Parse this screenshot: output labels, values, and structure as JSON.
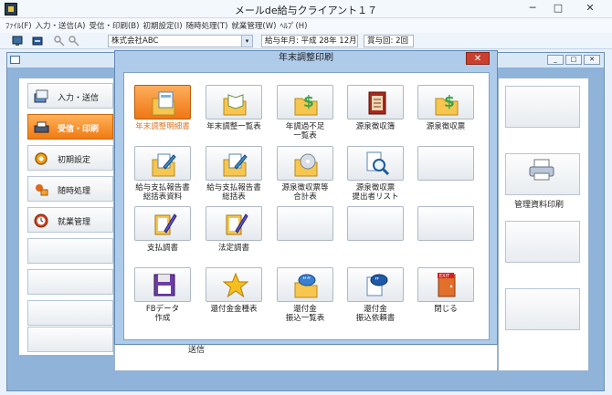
{
  "window": {
    "title": "メールde給与クライアント１７",
    "minimize": "─",
    "maximize": "□",
    "close": "✕"
  },
  "menu": [
    "ﾌｧｲﾙ(F)",
    "入力・送信(A)",
    "受信・印刷(B)",
    "初期設定(I)",
    "随時処理(T)",
    "就業管理(W)",
    "ﾍﾙﾌﾟ(H)"
  ],
  "toolbar": {
    "company": "株式会社ABC",
    "pay_year_month": "給与年月: 平成 28年 12月",
    "bonus_count": "賞与回: 2回",
    "dropdown_glyph": "▾"
  },
  "mdi_buttons": [
    "_",
    "□",
    "✕"
  ],
  "nav": [
    {
      "label": "入力・送信",
      "icon": "input-send-icon"
    },
    {
      "label": "受信・印刷",
      "icon": "receive-print-icon",
      "active": true
    },
    {
      "label": "初期設定",
      "icon": "settings-gear-icon"
    },
    {
      "label": "随時処理",
      "icon": "tools-icon"
    },
    {
      "label": "就業管理",
      "icon": "clock-icon"
    }
  ],
  "right_panel": {
    "printer_label": "管理資料印刷"
  },
  "under_label": "送信",
  "dialog": {
    "title": "年末調整印刷",
    "close": "✕",
    "tiles": [
      {
        "lines": [
          "年末調整明細書"
        ],
        "icon": "folder-doc-icon",
        "selected": true
      },
      {
        "lines": [
          "年末調整一覧表"
        ],
        "icon": "folder-book-icon"
      },
      {
        "lines": [
          "年調過不足",
          "一覧表"
        ],
        "icon": "folder-dollar-icon"
      },
      {
        "lines": [
          "源泉徴収簿"
        ],
        "icon": "red-ledger-icon"
      },
      {
        "lines": [
          "源泉徴収票"
        ],
        "icon": "folder-dollar-icon"
      },
      {
        "lines": [
          "給与支払報告書",
          "総括表資料"
        ],
        "icon": "folder-pencil-icon"
      },
      {
        "lines": [
          "給与支払報告書",
          "総括表"
        ],
        "icon": "folder-pencil-icon"
      },
      {
        "lines": [
          "源泉徴収票等",
          "合計表"
        ],
        "icon": "folder-cd-icon"
      },
      {
        "lines": [
          "源泉徴収票",
          "提出者リスト"
        ],
        "icon": "magnifier-doc-icon"
      },
      {
        "lines": [],
        "icon": ""
      },
      {
        "lines": [
          "支払調書"
        ],
        "icon": "clipboard-pen-icon"
      },
      {
        "lines": [
          "法定調書"
        ],
        "icon": "clipboard-pen-icon"
      },
      {
        "lines": [],
        "icon": ""
      },
      {
        "lines": [],
        "icon": ""
      },
      {
        "lines": [],
        "icon": ""
      },
      {
        "lines": [
          "FBデータ",
          "作成"
        ],
        "icon": "floppy-disk-icon"
      },
      {
        "lines": [
          "還付金金種表"
        ],
        "icon": "star-icon"
      },
      {
        "lines": [
          "還付金",
          "振込一覧表"
        ],
        "icon": "speech-folder-icon"
      },
      {
        "lines": [
          "還付金",
          "振込依頼書"
        ],
        "icon": "speech-doc-icon"
      },
      {
        "lines": [
          "閉じる"
        ],
        "icon": "exit-door-icon"
      }
    ]
  },
  "colors": {
    "accent_orange": "#f07a13",
    "dialog_frame": "#aecbea",
    "mdi_frame": "#8fb3d9"
  }
}
